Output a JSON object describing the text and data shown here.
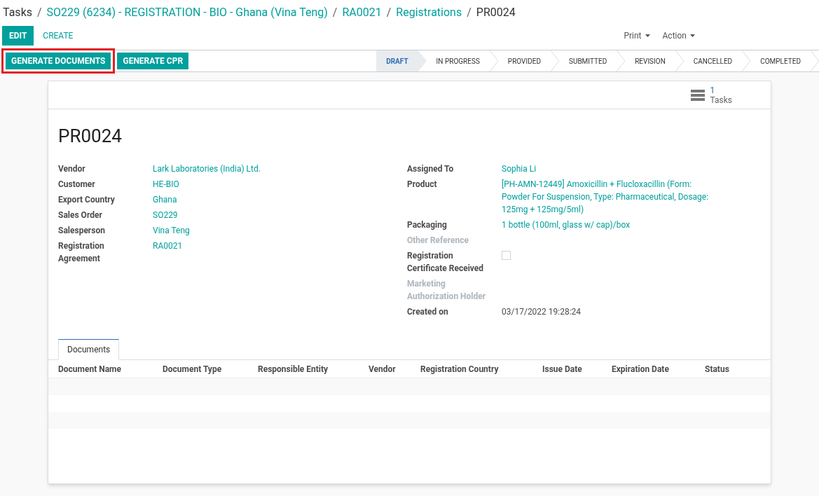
{
  "breadcrumbs": [
    {
      "label": "Tasks",
      "link": false
    },
    {
      "label": "SO229 (6234) - REGISTRATION - BIO - Ghana (Vina Teng)",
      "link": true
    },
    {
      "label": "RA0021",
      "link": true
    },
    {
      "label": "Registrations",
      "link": true
    },
    {
      "label": "PR0024",
      "link": false
    }
  ],
  "separator": "/",
  "actions": [
    {
      "label": "EDIT",
      "kind": "primary"
    },
    {
      "label": "CREATE",
      "kind": "link"
    }
  ],
  "menus": [
    "Print",
    "Action"
  ],
  "header_buttons": [
    {
      "label": "GENERATE DOCUMENTS",
      "highlighted": true
    },
    {
      "label": "GENERATE CPR",
      "highlighted": false
    }
  ],
  "stages": [
    {
      "label": "DRAFT",
      "selected": true
    },
    {
      "label": "IN PROGRESS",
      "selected": false
    },
    {
      "label": "PROVIDED",
      "selected": false
    },
    {
      "label": "SUBMITTED",
      "selected": false
    },
    {
      "label": "REVISION",
      "selected": false
    },
    {
      "label": "CANCELLED",
      "selected": false
    },
    {
      "label": "COMPLETED",
      "selected": false
    }
  ],
  "smart_button": {
    "count": "1",
    "label": "Tasks"
  },
  "title": "PR0024",
  "left_fields": [
    {
      "label": "Vendor",
      "kind": "link",
      "value": "Lark Laboratories (India) Ltd.",
      "muted": false
    },
    {
      "label": "Customer",
      "kind": "link",
      "value": "HE-BIO",
      "muted": false
    },
    {
      "label": "Export Country",
      "kind": "link",
      "value": "Ghana",
      "muted": false
    },
    {
      "label": "Sales Order",
      "kind": "link",
      "value": "SO229",
      "muted": false
    },
    {
      "label": "Salesperson",
      "kind": "link",
      "value": "Vina Teng",
      "muted": false
    },
    {
      "label": "Registration Agreement",
      "kind": "link",
      "value": "RA0021",
      "muted": false
    }
  ],
  "right_fields": [
    {
      "label": "Assigned To",
      "kind": "link",
      "value": "Sophia Li",
      "muted": false
    },
    {
      "label": "Product",
      "kind": "link",
      "value": "[PH-AMN-12449] Amoxicillin + Flucloxacillin (Form: Powder For Suspension, Type: Pharmaceutical, Dosage: 125mg + 125mg/5ml)",
      "muted": false
    },
    {
      "label": "Packaging",
      "kind": "link",
      "value": "1 bottle (100ml, glass w/ cap)/box",
      "muted": false
    },
    {
      "label": "Other Reference",
      "kind": "empty",
      "muted": true
    },
    {
      "label": "Registration Certificate Received",
      "kind": "checkbox",
      "checked": false,
      "muted": false
    },
    {
      "label": "Marketing Authorization Holder",
      "kind": "empty",
      "muted": true
    },
    {
      "label": "Created on",
      "kind": "text",
      "value": "03/17/2022 19:28:24",
      "muted": false
    }
  ],
  "tabs": [
    {
      "label": "Documents",
      "selected": true
    }
  ],
  "table": {
    "columns": [
      "Document Name",
      "Document Type",
      "Responsible Entity",
      "Vendor",
      "Registration Country",
      "Issue Date",
      "Expiration Date",
      "Status"
    ]
  }
}
